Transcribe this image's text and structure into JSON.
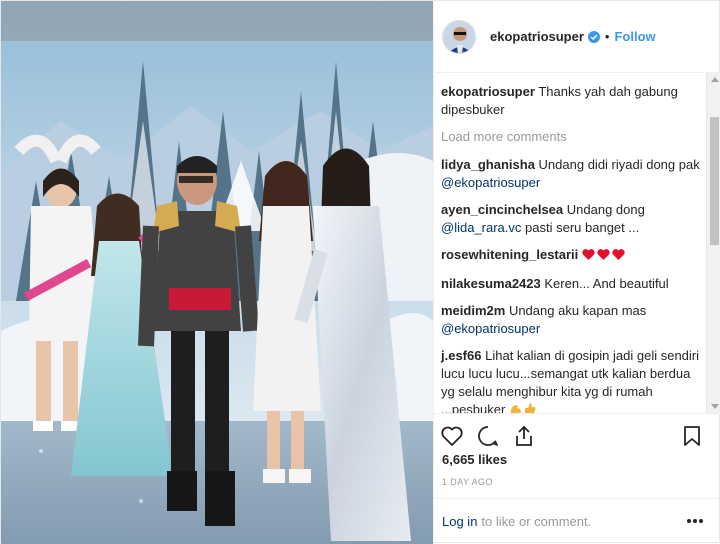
{
  "header": {
    "username": "ekopatriosuper",
    "separator": "•",
    "follow_label": "Follow"
  },
  "caption": {
    "username": "ekopatriosuper",
    "text": "Thanks yah dah gabung dipesbuker"
  },
  "load_more_label": "Load more comments",
  "comments": [
    {
      "username": "lidya_ghanisha",
      "text": "Undang didi riyadi dong pak",
      "mention": "@ekopatriosuper",
      "after": ""
    },
    {
      "username": "ayen_cincinchelsea",
      "text": "Undang dong",
      "mention": "@lida_rara.vc",
      "after": "pasti seru banget ..."
    },
    {
      "username": "rosewhitening_lestarii",
      "text": "",
      "mention": "",
      "after": ""
    },
    {
      "username": "nilakesuma2423",
      "text": "Keren... And beautiful",
      "mention": "",
      "after": ""
    },
    {
      "username": "meidim2m",
      "text": "Undang aku kapan mas",
      "mention": "@ekopatriosuper",
      "after": ""
    },
    {
      "username": "j.esf66",
      "text": "Lihat kalian di gosipin jadi geli sendiri lucu lucu lucu...semangat utk kalian berdua yg selalu menghibur kita yg di rumah ...pesbuker",
      "mention": "",
      "after": ""
    }
  ],
  "icons": {
    "like": "heart-icon",
    "comment": "comment-bubble-icon",
    "share": "share-icon",
    "save": "bookmark-icon",
    "more": "more-options-icon",
    "verified": "verified-badge-icon"
  },
  "likes": "6,665 likes",
  "time_ago": "1 DAY AGO",
  "footer": {
    "login_label": "Log in",
    "suffix": "to like or comment."
  },
  "colors": {
    "accent": "#3897f0",
    "mention": "#003569",
    "muted": "#999999",
    "text": "#262626",
    "heart": "#e0112b"
  }
}
